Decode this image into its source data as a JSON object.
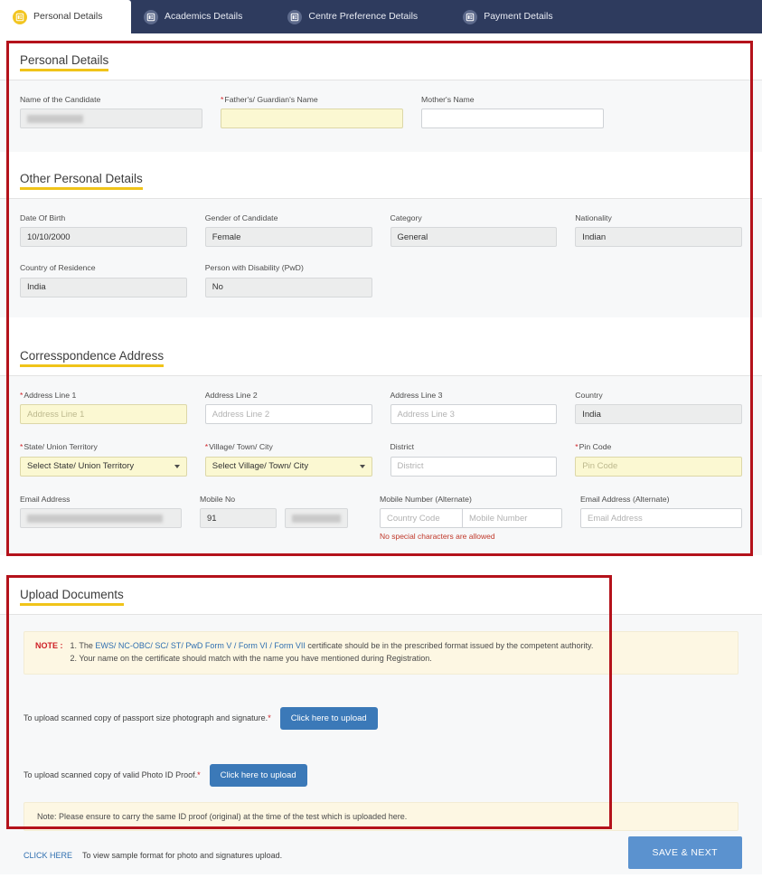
{
  "tabs": [
    {
      "label": "Personal Details",
      "icon": "id-card-icon",
      "active": true
    },
    {
      "label": "Academics Details",
      "icon": "id-card-icon",
      "active": false
    },
    {
      "label": "Centre Preference Details",
      "icon": "id-card-icon",
      "active": false
    },
    {
      "label": "Payment Details",
      "icon": "id-card-icon",
      "active": false
    }
  ],
  "personal_details": {
    "heading": "Personal Details",
    "name_label": "Name of the Candidate",
    "name_value": "",
    "father_label": "Father's/ Guardian's Name",
    "father_value": "",
    "mother_label": "Mother's Name",
    "mother_value": ""
  },
  "other_personal_details": {
    "heading": "Other Personal Details",
    "dob_label": "Date Of Birth",
    "dob_value": "10/10/2000",
    "gender_label": "Gender of Candidate",
    "gender_value": "Female",
    "category_label": "Category",
    "category_value": "General",
    "nationality_label": "Nationality",
    "nationality_value": "Indian",
    "country_residence_label": "Country of Residence",
    "country_residence_value": "India",
    "pwd_label": "Person with Disability (PwD)",
    "pwd_value": "No"
  },
  "correspondence_address": {
    "heading": "Corresspondence Address",
    "address1_label": "Address Line 1",
    "address1_placeholder": "Address Line 1",
    "address2_label": "Address Line 2",
    "address2_placeholder": "Address Line 2",
    "address3_label": "Address Line 3",
    "address3_placeholder": "Address Line 3",
    "country_label": "Country",
    "country_value": "India",
    "state_label": "State/ Union Territory",
    "state_value": "Select State/ Union Territory",
    "village_label": "Village/ Town/ City",
    "village_value": "Select Village/ Town/ City",
    "district_label": "District",
    "district_placeholder": "District",
    "pincode_label": "Pin Code",
    "pincode_placeholder": "Pin Code",
    "email_label": "Email Address",
    "email_value": "",
    "mobile_label": "Mobile No",
    "mobile_code_value": "91",
    "mobile_number_value": "",
    "alt_mobile_label": "Mobile Number (Alternate)",
    "alt_mobile_code_placeholder": "Country Code",
    "alt_mobile_placeholder": "Mobile Number",
    "alt_mobile_error": "No special characters are allowed",
    "alt_email_label": "Email Address (Alternate)",
    "alt_email_placeholder": "Email Address"
  },
  "upload_documents": {
    "heading": "Upload Documents",
    "note_word": "NOTE :",
    "note_line1_pre": "1. The ",
    "note_line1_link": "EWS/ NC-OBC/ SC/ ST/ PwD Form V / Form VI / Form VII",
    "note_line1_post": " certificate should be in the prescribed format issued by the competent authority.",
    "note_line2": "2. Your name on the certificate should match with the name you have mentioned during Registration.",
    "photo_label": "To upload scanned copy of passport size photograph and signature.",
    "photo_required_mark": "*",
    "photo_button": "Click here to upload",
    "id_label": "To upload scanned copy of valid Photo ID Proof.",
    "id_required_mark": "*",
    "id_button": "Click here to upload",
    "id_note": "Note: Please ensure to carry the same ID proof (original) at the time of the test which is uploaded here.",
    "click_here": "CLICK HERE",
    "click_here_text": "To view sample format for photo and signatures upload."
  },
  "footer": {
    "save_label": "SAVE & NEXT"
  },
  "colors": {
    "header_bar": "#2e3b5e",
    "active_tab_icon": "#f2c521",
    "inactive_tab_icon": "#5d6a8c",
    "heading_underline": "#f0c419",
    "required_red": "#cf2026",
    "annotation_red": "#b4121b",
    "highlight_yellow": "#fbf8d2",
    "note_background": "#fdf7e3",
    "link_blue": "#2f6fb0",
    "upload_button": "#3b79b8",
    "save_button": "#5b92cf"
  }
}
